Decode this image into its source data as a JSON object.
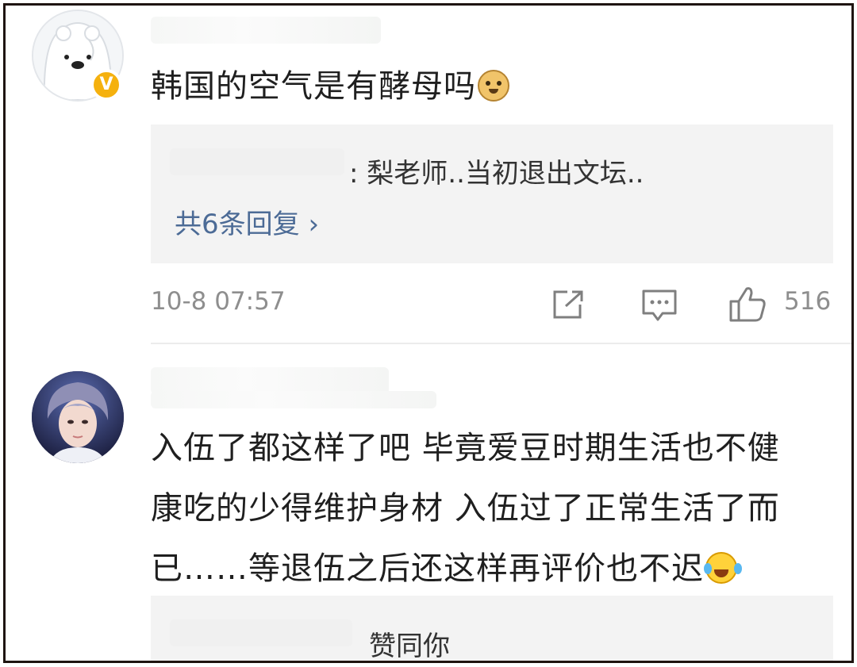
{
  "comments": [
    {
      "avatar_icon": "polar-bear-avatar",
      "badge_label": "V",
      "text": "韩国的空气是有酵母吗",
      "emoji": "doge-emoji",
      "reply_preview": ": 梨老师..当初退出文坛..",
      "more_replies": "共6条回复 ›",
      "timestamp": "10-8 07:57",
      "likes": "516"
    },
    {
      "avatar_icon": "person-avatar",
      "text_lines": [
        "入伍了都这样了吧 毕竟爱豆时期生活也不健",
        "康吃的少得维护身材 入伍过了正常生活了而",
        "已……等退伍之后还这样再评价也不迟"
      ],
      "emoji": "laughing-crying-emoji",
      "reply_preview": "赞同你"
    }
  ],
  "colors": {
    "link_blue": "#4c6b96",
    "badge_gold": "#f5b10e",
    "reply_bg": "#f3f3f3"
  }
}
